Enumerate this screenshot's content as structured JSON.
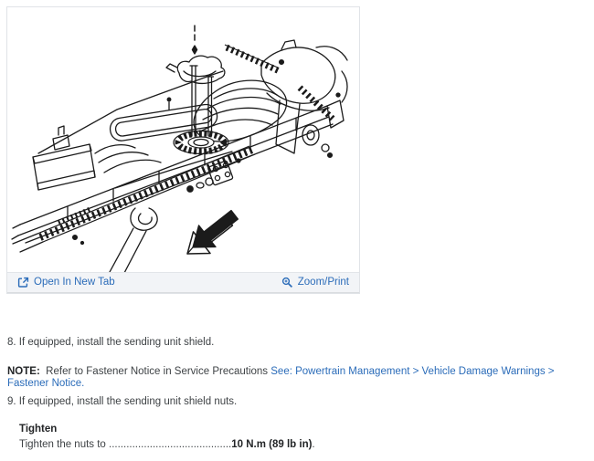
{
  "figure": {
    "alt": "truck-chassis-fuel-sending-unit-installation-diagram",
    "toolbar": {
      "open_label": "Open In New Tab",
      "zoom_label": "Zoom/Print",
      "open_icon": "open-in-new-tab-icon",
      "zoom_icon": "magnifier-zoom-icon"
    }
  },
  "content": {
    "step8": "8. If equipped, install the sending unit shield.",
    "note": {
      "label": "NOTE:",
      "text": "  Refer to Fastener Notice in Service Precautions ",
      "link": "See: Powertrain Management > Vehicle Damage Warnings > Fastener Notice."
    },
    "step9": "9. If equipped, install the sending unit shield nuts.",
    "tighten": {
      "label": "Tighten",
      "prefix": "Tighten the nuts to ",
      "dots": "..........................................",
      "value": "10 N.m (89 lb in)",
      "suffix": "."
    }
  },
  "colors": {
    "link_blue": "#2b6cb9",
    "toolbar_bg": "#f2f4f7",
    "border": "#e0e3e7",
    "text": "#3e4245",
    "line_art": "#1b1b1b"
  }
}
